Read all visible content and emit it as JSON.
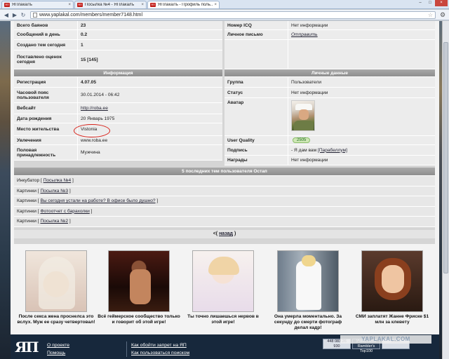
{
  "browser": {
    "tabs": [
      {
        "label": "ЯПлакалъ",
        "active": false
      },
      {
        "label": "Посылка №4 - ЯПлакалъ",
        "active": false
      },
      {
        "label": "ЯПлакалъ - Профиль поль...",
        "active": true
      }
    ],
    "url": "www.yaplakal.com/members/member7148.html"
  },
  "stats": [
    {
      "key": "Всего баянов",
      "value": "23"
    },
    {
      "key": "Сообщений в день",
      "value": "0.2"
    },
    {
      "key": "Создано тем сегодня",
      "value": "1"
    },
    {
      "key": "Поставлено оценок сегодня",
      "value": "15 [145]"
    }
  ],
  "contacts": [
    {
      "key": "Номер ICQ",
      "value": "Нет информации"
    },
    {
      "key": "Личное письмо",
      "value": "Отправить"
    }
  ],
  "info": {
    "title": "Информация",
    "rows": [
      {
        "key": "Регистрация",
        "value": "4.07.05",
        "bold": true
      },
      {
        "key": "Часовой пояс пользователя",
        "value": "30.01.2014 - 06:42"
      },
      {
        "key": "Вебсайт",
        "value": "http://roba.ee",
        "link": true
      },
      {
        "key": "Дата рождения",
        "value": "20 Январь 1975"
      },
      {
        "key": "Место жительства",
        "value": "Vistonia"
      },
      {
        "key": "Увлечения",
        "value": "www.roba.ee"
      },
      {
        "key": "Половая принадлежность",
        "value": "Мужчина"
      }
    ]
  },
  "personal": {
    "title": "Личные данные",
    "group_key": "Группа",
    "group_value": "Пользователи",
    "status_key": "Статус",
    "status_value": "Нет информации",
    "avatar_key": "Аватар",
    "quality_key": "User Quality",
    "quality_value": "2505",
    "signature_key": "Подпись",
    "signature_prefix": "- Я дам вам",
    "signature_link": "[Парабеллум]",
    "awards_key": "Награды",
    "awards_value": "Нет информации"
  },
  "last_topics": {
    "title": "5 последних тем пользователя Остап",
    "items": [
      {
        "section": "Инкубатор",
        "topic": "Посылка №4"
      },
      {
        "section": "Картинки",
        "topic": "Посылка №3"
      },
      {
        "section": "Картинки",
        "topic": "Вы сегодня устали на работе? В офисе было душно?"
      },
      {
        "section": "Картинки",
        "topic": "Фотоотчет с барахолки"
      },
      {
        "section": "Картинки",
        "topic": "Посылка №2"
      }
    ],
    "back_prefix": "<(",
    "back_label": "назад",
    "back_suffix": ")"
  },
  "thumbnails": [
    {
      "caption": "После секса жена проснелса это вслух. Муж ее сразу четвертовал!"
    },
    {
      "caption": "Всё геймерское сообщество только и говорит об этой игре!"
    },
    {
      "caption": "Ты точно лишаешься нервов в этой игре!"
    },
    {
      "caption": "Она умерла моментально. За секунду до смерти фотограф делал кадр!"
    },
    {
      "caption": "СМИ заплатят Жанне Фриске $1 млн за клевету"
    }
  ],
  "footer": {
    "logo": "ЯП",
    "links_left": [
      "О проекте",
      "Помощь"
    ],
    "links_right": [
      "Как обойти запрет на ЯП",
      "Как пользоваться поиском"
    ],
    "counters": [
      "448 083 26 930",
      "УЧАСТНИК Rambler's Top100",
      "2500"
    ],
    "watermark": "YAPLAKAL.COM"
  },
  "colors": {
    "accent": "#d8231b",
    "header_gray": "#9a9a9a",
    "footer_bg": "#17283c"
  }
}
